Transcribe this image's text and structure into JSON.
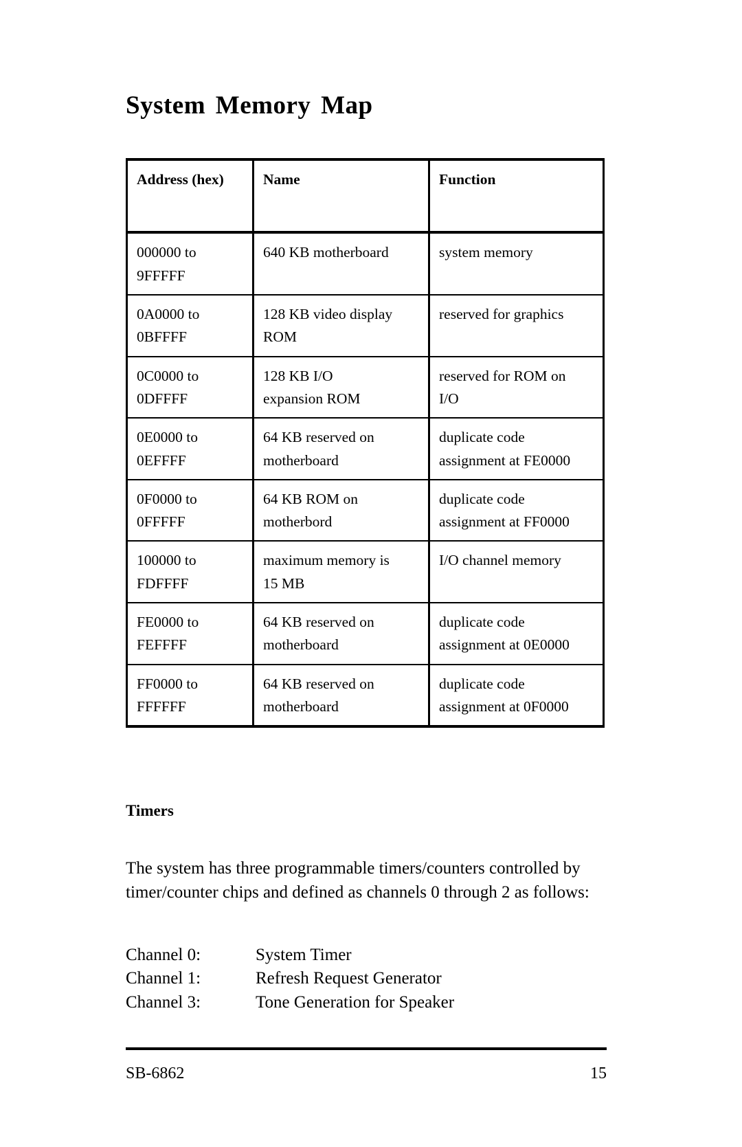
{
  "document": {
    "title": "System Memory Map"
  },
  "table": {
    "headers": [
      "Address (hex)",
      "Name",
      "Function"
    ],
    "rows": [
      {
        "address": [
          "000000 to",
          "9FFFFF"
        ],
        "name": [
          "640 KB motherboard"
        ],
        "function": [
          "system memory"
        ]
      },
      {
        "address": [
          "0A0000 to",
          "0BFFFF"
        ],
        "name": [
          "128 KB video display",
          "ROM"
        ],
        "function": [
          "reserved for graphics"
        ]
      },
      {
        "address": [
          "0C0000 to",
          "0DFFFF"
        ],
        "name": [
          "128 KB I/O",
          "expansion ROM"
        ],
        "function": [
          "reserved for ROM on",
          "I/O"
        ]
      },
      {
        "address": [
          "0E0000 to",
          "0EFFFF"
        ],
        "name": [
          "64 KB reserved on",
          "motherboard"
        ],
        "function": [
          "duplicate code",
          "assignment at FE0000"
        ]
      },
      {
        "address": [
          "0F0000 to",
          "0FFFFF"
        ],
        "name": [
          "64 KB ROM on",
          "motherbord"
        ],
        "function": [
          "duplicate code",
          "assignment at FF0000"
        ]
      },
      {
        "address": [
          "100000 to",
          "FDFFFF"
        ],
        "name": [
          "maximum memory is",
          "15 MB"
        ],
        "function": [
          "I/O channel memory"
        ]
      },
      {
        "address": [
          "FE0000 to",
          "FEFFFF"
        ],
        "name": [
          "64 KB reserved on",
          "motherboard"
        ],
        "function": [
          "duplicate code",
          "assignment at 0E0000"
        ]
      },
      {
        "address": [
          "FF0000 to",
          "FFFFFF"
        ],
        "name": [
          "64 KB reserved on",
          "motherboard"
        ],
        "function": [
          "duplicate code",
          "assignment at 0F0000"
        ]
      }
    ]
  },
  "timers": {
    "heading": "Timers",
    "paragraph": "The system has three programmable timers/counters controlled by timer/counter chips and defined as channels 0 through 2 as follows:",
    "channels": [
      {
        "label": "Channel 0:",
        "value": "System Timer"
      },
      {
        "label": "Channel 1:",
        "value": "Refresh Request Generator"
      },
      {
        "label": "Channel 3:",
        "value": "Tone Generation for Speaker"
      }
    ]
  },
  "footer": {
    "left": "SB-6862",
    "page_number": "15"
  }
}
